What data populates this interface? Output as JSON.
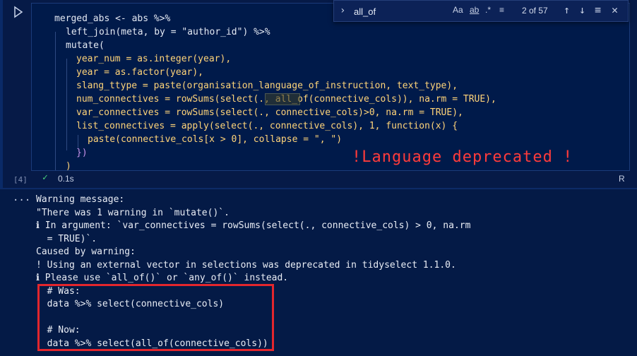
{
  "find": {
    "query": "all_of",
    "match_case": "Aa",
    "whole_word": "ab",
    "regex": ".*",
    "count": "2 of 57"
  },
  "cell": {
    "exec_count": "[4]",
    "duration": "0.1s",
    "language": "R"
  },
  "annotation": "!Language deprecated !",
  "code_lines": [
    "merged_abs <- abs %>%",
    "left_join(meta, by = \"author_id\") %>%",
    "mutate(",
    "year_num = as.integer(year),",
    "year = as.factor(year),",
    "slang_ttype = paste(organisation_language_of_instruction, text_type),",
    "num_connectives = rowSums(select(., all_of(connective_cols)), na.rm = TRUE),",
    "var_connectives = rowSums(select(., connective_cols)>0, na.rm = TRUE),",
    "list_connectives = apply(select(., connective_cols), 1, function(x) {",
    "paste(connective_cols[x > 0], collapse = \", \")",
    "})",
    ")"
  ],
  "output_lines": [
    "Warning message:",
    "\"There was 1 warning in `mutate()`.",
    "ℹ In argument: `var_connectives = rowSums(select(., connective_cols) > 0, na.rm",
    "  = TRUE)`.",
    "Caused by warning:",
    "! Using an external vector in selections was deprecated in tidyselect 1.1.0.",
    "ℹ Please use `all_of()` or `any_of()` instead.",
    "  # Was:",
    "  data %>% select(connective_cols)",
    "",
    "  # Now:",
    "  data %>% select(all_of(connective_cols))"
  ],
  "colors": {
    "background": "#041a46",
    "annotation": "#ff3b3b",
    "highlight_box": "#e3262d",
    "success": "#48d17d"
  }
}
